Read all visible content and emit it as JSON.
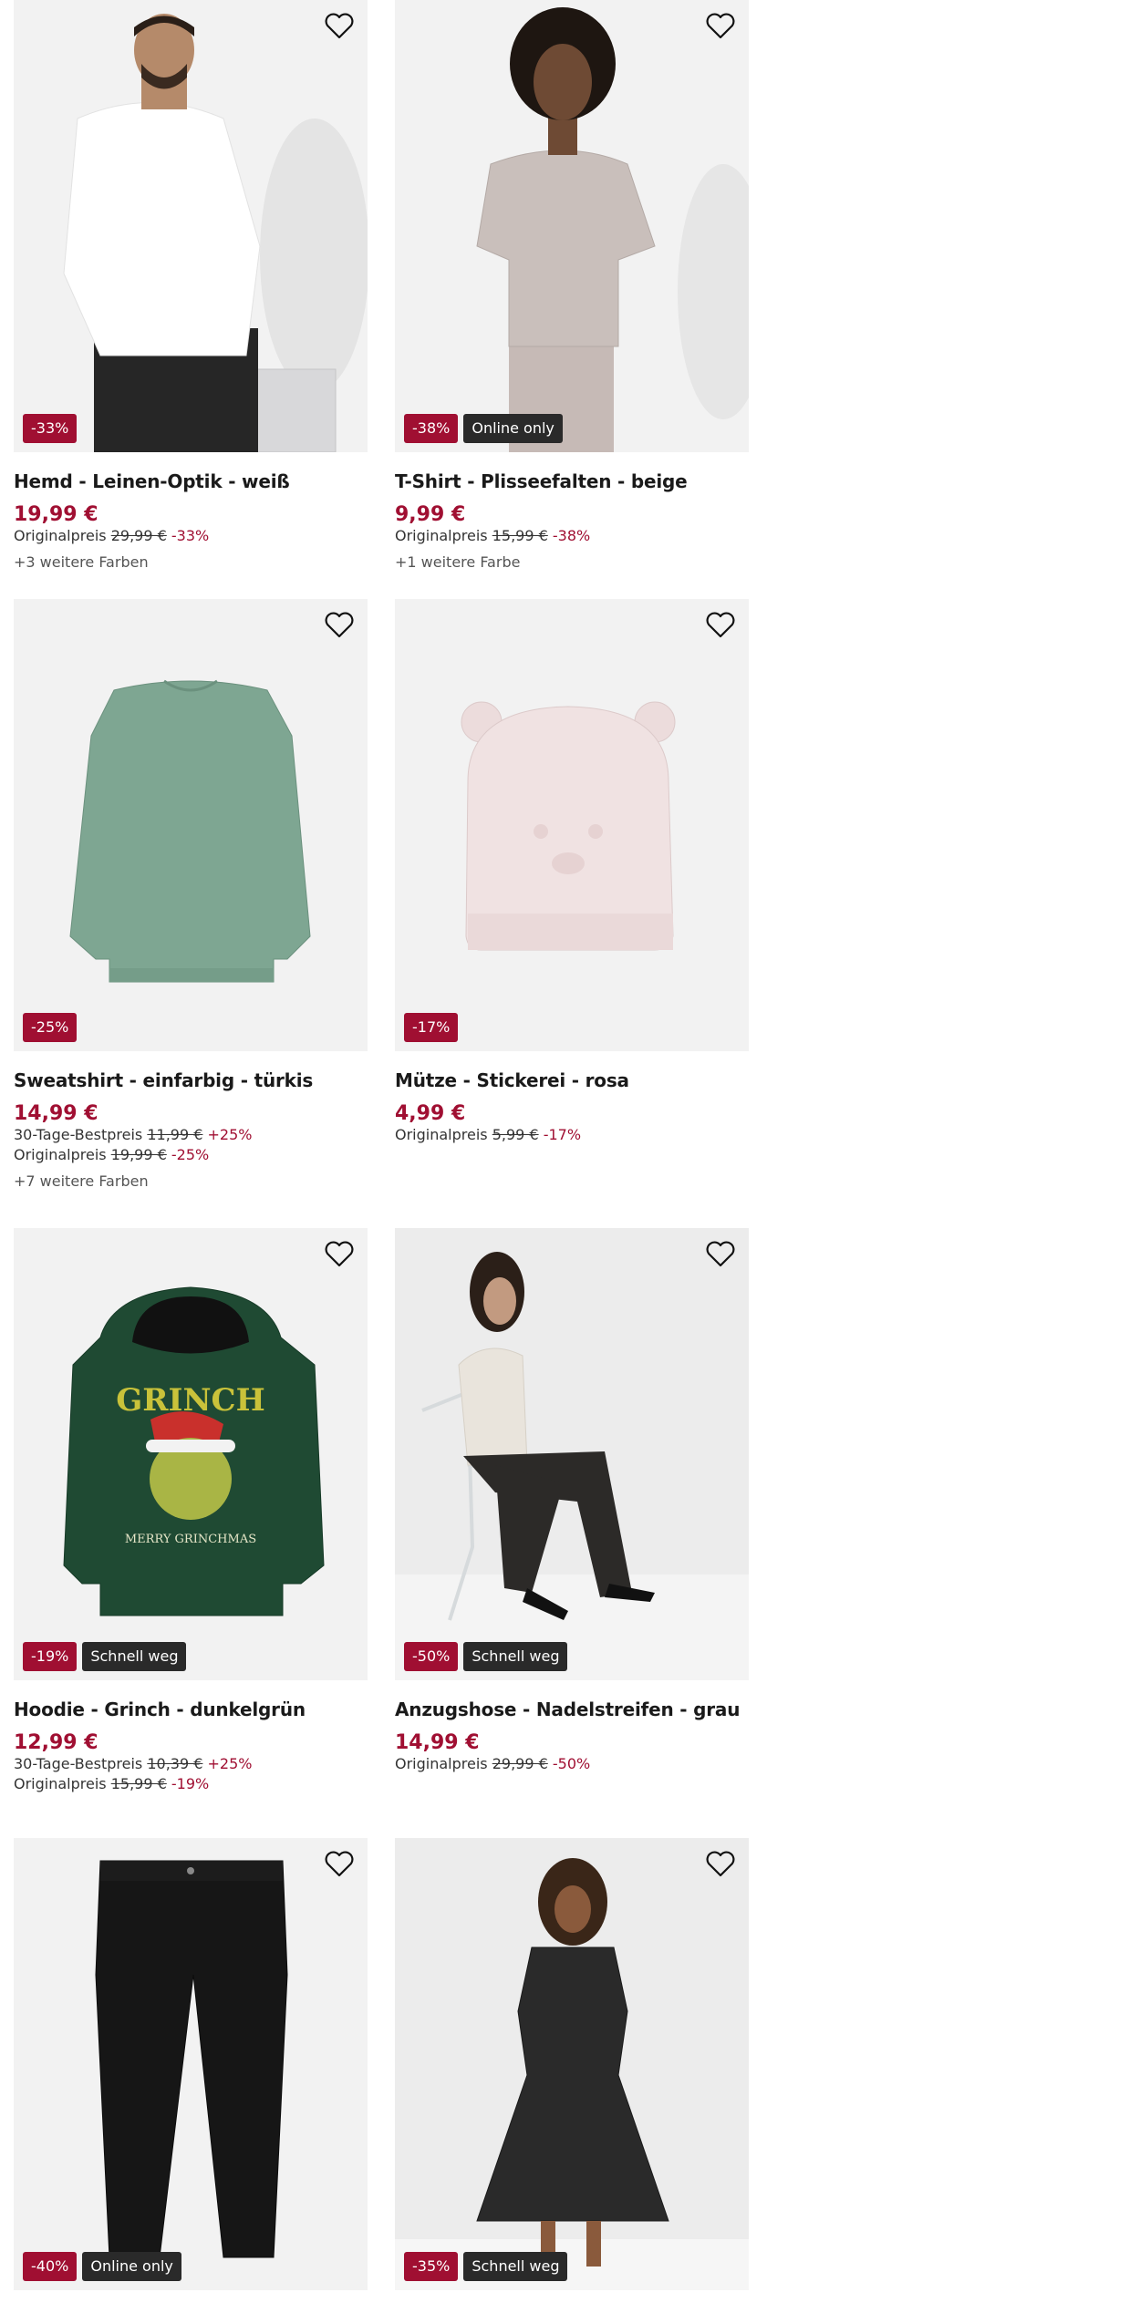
{
  "products": [
    {
      "name": "Hemd - Leinen-Optik - weiß",
      "price": "19,99 €",
      "lines": [
        {
          "label": "Originalpreis",
          "old": "29,99 €",
          "pct": "-33%"
        }
      ],
      "more": "+3 weitere Farben",
      "badges": [
        {
          "text": "-33%",
          "kind": "discount"
        }
      ],
      "image": "man in white shirt and black jeans"
    },
    {
      "name": "T-Shirt - Plisseefalten - beige",
      "price": "9,99 €",
      "lines": [
        {
          "label": "Originalpreis",
          "old": "15,99 €",
          "pct": "-38%"
        }
      ],
      "more": "+1 weitere Farbe",
      "badges": [
        {
          "text": "-38%",
          "kind": "discount"
        },
        {
          "text": "Online only",
          "kind": "label"
        }
      ],
      "image": "woman in beige pleated t-shirt"
    },
    {
      "name": "Sweatshirt - einfarbig - türkis",
      "price": "14,99 €",
      "lines": [
        {
          "label": "30-Tage-Bestpreis",
          "old": "11,99 €",
          "pct": "+25%"
        },
        {
          "label": "Originalpreis",
          "old": "19,99 €",
          "pct": "-25%"
        }
      ],
      "more": "+7 weitere Farben",
      "badges": [
        {
          "text": "-25%",
          "kind": "discount"
        }
      ],
      "image": "green sweatshirt"
    },
    {
      "name": "Mütze - Stickerei - rosa",
      "price": "4,99 €",
      "lines": [
        {
          "label": "Originalpreis",
          "old": "5,99 €",
          "pct": "-17%"
        }
      ],
      "more": "",
      "badges": [
        {
          "text": "-17%",
          "kind": "discount"
        }
      ],
      "image": "pink baby hat with ears"
    },
    {
      "name": "Hoodie - Grinch - dunkelgrün",
      "price": "12,99 €",
      "lines": [
        {
          "label": "30-Tage-Bestpreis",
          "old": "10,39 €",
          "pct": "+25%"
        },
        {
          "label": "Originalpreis",
          "old": "15,99 €",
          "pct": "-19%"
        }
      ],
      "more": "",
      "badges": [
        {
          "text": "-19%",
          "kind": "discount"
        },
        {
          "text": "Schnell weg",
          "kind": "label"
        }
      ],
      "image": "dark green grinch hoodie"
    },
    {
      "name": "Anzugshose - Nadelstreifen - grau",
      "price": "14,99 €",
      "lines": [
        {
          "label": "Originalpreis",
          "old": "29,99 €",
          "pct": "-50%"
        }
      ],
      "more": "",
      "badges": [
        {
          "text": "-50%",
          "kind": "discount"
        },
        {
          "text": "Schnell weg",
          "kind": "label"
        }
      ],
      "image": "woman seated in pinstripe trousers"
    },
    {
      "name": "",
      "price": "",
      "lines": [],
      "more": "",
      "badges": [
        {
          "text": "-40%",
          "kind": "discount"
        },
        {
          "text": "Online only",
          "kind": "label"
        }
      ],
      "image": "black jeans"
    },
    {
      "name": "",
      "price": "",
      "lines": [],
      "more": "",
      "badges": [
        {
          "text": "-35%",
          "kind": "discount"
        },
        {
          "text": "Schnell weg",
          "kind": "label"
        }
      ],
      "image": "woman in dark glitter dress"
    }
  ],
  "colors": {
    "discount": "#a00f32",
    "label": "#2a2a2a",
    "tile": "#f2f2f2"
  },
  "icons": {
    "favorite": "heart-outline-icon"
  }
}
